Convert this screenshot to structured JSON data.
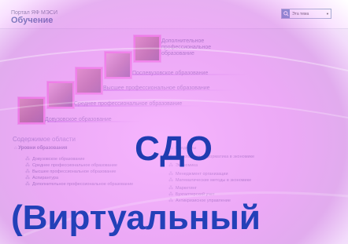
{
  "portal": {
    "name": "Портал ЯФ МЭСИ",
    "title": "Обучение",
    "search": {
      "value": "Эта тема"
    }
  },
  "levels": [
    {
      "label": "Довузовское образование"
    },
    {
      "label": "Среднее профессиональное образование"
    },
    {
      "label": "Высшее профессиональное образование"
    },
    {
      "label": "Послевузовское образование"
    },
    {
      "label": "Дополнительное профессиональное образование",
      "lines": [
        "Дополнительное",
        "профессиональное",
        "образование"
      ]
    }
  ],
  "sections": {
    "title": "Содержимое области",
    "column_head": "Уровни образования",
    "left_links": [
      "Довузовское образование",
      "Среднее профессиональное образование",
      "Высшее профессиональное образование",
      "Аспирантура",
      "Дополнительное профессиональное образование"
    ],
    "right_links": [
      "Предметы",
      "Прикладная информатика в экономике",
      "Экономика",
      "Менеджмент организации",
      "Математические методы в экономике",
      "Маркетинг",
      "Бухгалтерский учет",
      "Антикризисное управление"
    ]
  },
  "overlay": {
    "big_label": "СДО",
    "bottom_label": "(Виртуальный"
  }
}
